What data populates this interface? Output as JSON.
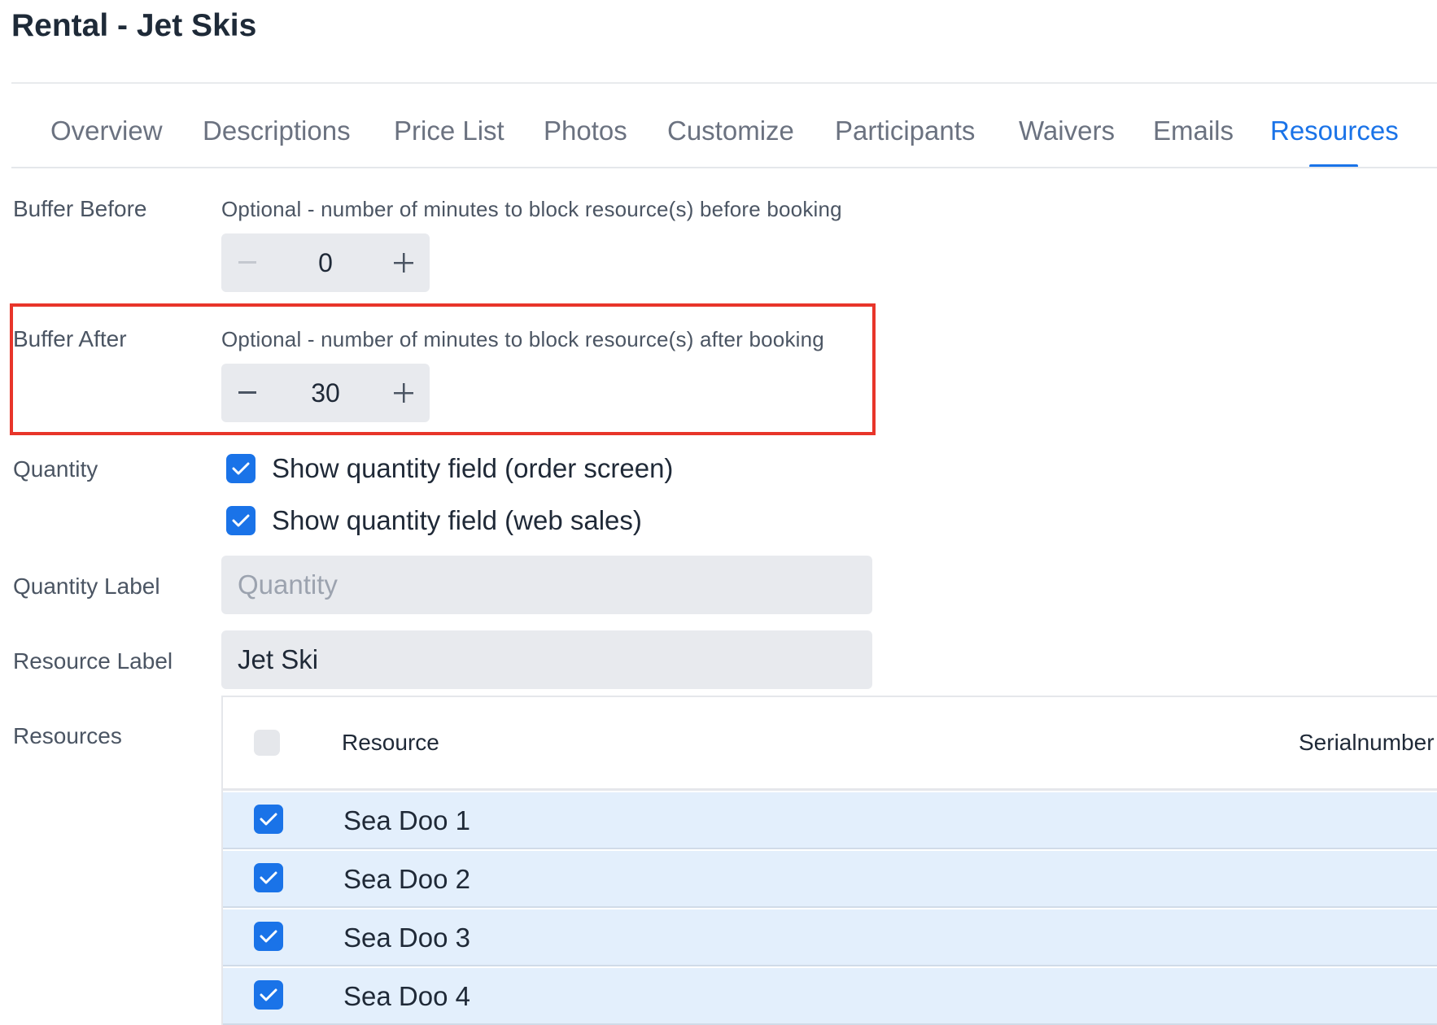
{
  "page": {
    "title": "Rental - Jet Skis"
  },
  "tabs": [
    {
      "label": "Overview"
    },
    {
      "label": "Descriptions"
    },
    {
      "label": "Price List"
    },
    {
      "label": "Photos"
    },
    {
      "label": "Customize"
    },
    {
      "label": "Participants"
    },
    {
      "label": "Waivers"
    },
    {
      "label": "Emails"
    },
    {
      "label": "Resources",
      "active": true
    }
  ],
  "buffer_before": {
    "label": "Buffer Before",
    "help": "Optional - number of minutes to block resource(s) before booking",
    "value": "0"
  },
  "buffer_after": {
    "label": "Buffer After",
    "help": "Optional - number of minutes to block resource(s) after booking",
    "value": "30"
  },
  "quantity": {
    "label": "Quantity",
    "options": [
      {
        "label": "Show quantity field (order screen)",
        "checked": true
      },
      {
        "label": "Show quantity field (web sales)",
        "checked": true
      }
    ]
  },
  "quantity_label": {
    "label": "Quantity Label",
    "placeholder": "Quantity",
    "value": ""
  },
  "resource_label": {
    "label": "Resource Label",
    "value": "Jet Ski"
  },
  "resources": {
    "label": "Resources",
    "columns": [
      "Resource",
      "Serialnumber"
    ],
    "rows": [
      {
        "name": "Sea Doo 1",
        "checked": true
      },
      {
        "name": "Sea Doo 2",
        "checked": true
      },
      {
        "name": "Sea Doo 3",
        "checked": true
      },
      {
        "name": "Sea Doo 4",
        "checked": true
      }
    ]
  },
  "colors": {
    "accent": "#1a73e8",
    "highlight_border": "#e8352a",
    "selected_row": "#e3effc"
  }
}
